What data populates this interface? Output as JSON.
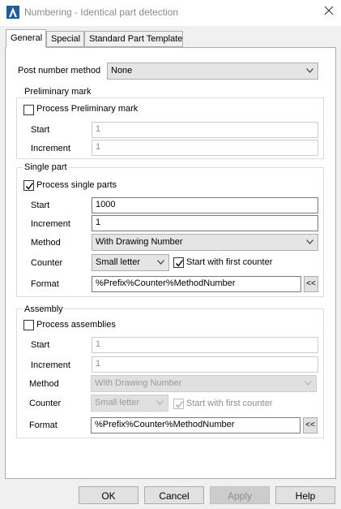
{
  "window": {
    "title": "Numbering - Identical part detection"
  },
  "tabs": [
    "General",
    "Special",
    "Standard Part Template"
  ],
  "post_number": {
    "label": "Post number method",
    "value": "None"
  },
  "preliminary": {
    "group_title": "Preliminary mark",
    "checkbox_label": "Process Preliminary mark",
    "checked": false,
    "start_label": "Start",
    "start_value": "1",
    "increment_label": "Increment",
    "increment_value": "1"
  },
  "single": {
    "group_title": "Single part",
    "checkbox_label": "Process single parts",
    "checked": true,
    "start_label": "Start",
    "start_value": "1000",
    "increment_label": "Increment",
    "increment_value": "1",
    "method_label": "Method",
    "method_value": "With Drawing Number",
    "counter_label": "Counter",
    "counter_value": "Small letter",
    "first_counter_label": "Start with first counter",
    "first_counter_checked": true,
    "format_label": "Format",
    "format_value": "%Prefix%Counter%MethodNumber",
    "format_button": "<<"
  },
  "assembly": {
    "group_title": "Assembly",
    "checkbox_label": "Process assemblies",
    "checked": false,
    "start_label": "Start",
    "start_value": "1",
    "increment_label": "Increment",
    "increment_value": "1",
    "method_label": "Method",
    "method_value": "With Drawing Number",
    "counter_label": "Counter",
    "counter_value": "Small letter",
    "first_counter_label": "Start with first counter",
    "first_counter_checked": true,
    "format_label": "Format",
    "format_value": "%Prefix%Counter%MethodNumber",
    "format_button": "<<"
  },
  "buttons": {
    "ok": "OK",
    "cancel": "Cancel",
    "apply": "Apply",
    "help": "Help"
  }
}
